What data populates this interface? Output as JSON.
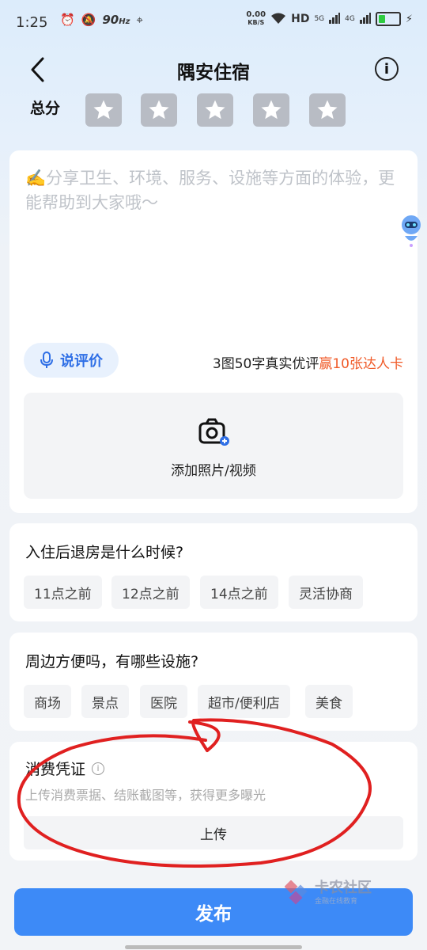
{
  "status_bar": {
    "time": "1:25",
    "refresh_rate": "90",
    "refresh_unit": "Hz",
    "net_speed_value": "0.00",
    "net_speed_unit": "KB/S",
    "hd_label": "HD",
    "net1": "5G",
    "net2": "4G"
  },
  "nav": {
    "title": "隅安住宿"
  },
  "rating": {
    "label": "总分",
    "max_stars": 5,
    "selected": 0
  },
  "review": {
    "placeholder": "✍️分享卫生、环境、服务、设施等方面的体验，更能帮助到大家哦～",
    "voice_label": "说评价",
    "promo_prefix": "3图50字真实优评",
    "promo_highlight": "赢10张达人卡",
    "photo_label": "添加照片/视频"
  },
  "questions": [
    {
      "title": "入住后退房是什么时候?",
      "options": [
        "11点之前",
        "12点之前",
        "14点之前",
        "灵活协商"
      ]
    },
    {
      "title": "周边方便吗，有哪些设施?",
      "options": [
        "商场",
        "景点",
        "医院",
        "超市/便利店",
        "美食"
      ]
    }
  ],
  "receipt": {
    "title": "消费凭证",
    "subtitle": "上传消费票据、结账截图等，获得更多曝光",
    "upload_label": "上传"
  },
  "publish_label": "发布",
  "watermark": {
    "title": "卡农社区",
    "subtitle": "金融在线教育"
  },
  "colors": {
    "accent": "#3d8af7",
    "promo": "#f05a28",
    "annotation": "#e02020"
  }
}
